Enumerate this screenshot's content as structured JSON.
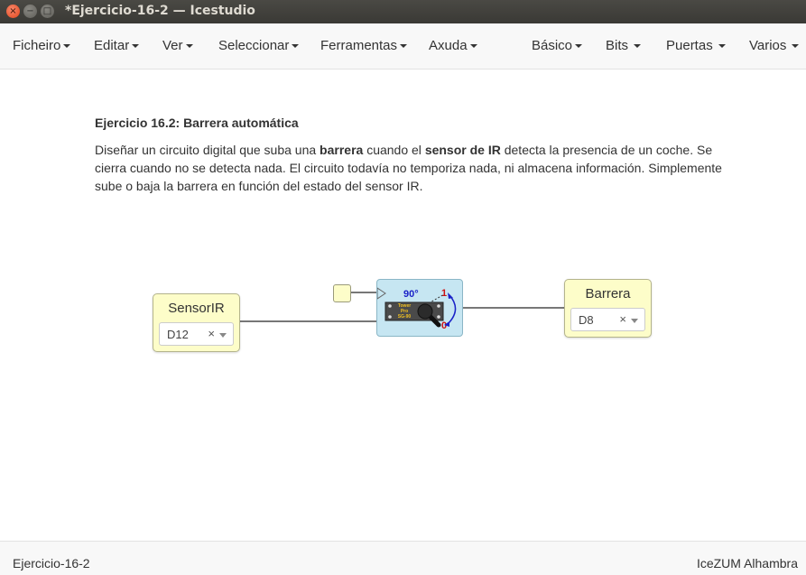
{
  "window": {
    "title": "*Ejercicio-16-2 — Icestudio",
    "close_glyph": "×",
    "min_glyph": "−",
    "max_glyph": "□"
  },
  "menubar": {
    "left": [
      "Ficheiro",
      "Editar",
      "Ver",
      "Seleccionar",
      "Ferramentas",
      "Axuda"
    ],
    "right": [
      "Básico",
      "Bits",
      "Puertas",
      "Varios"
    ]
  },
  "description": {
    "heading_bold": "Ejercicio 16.2",
    "heading_rest": ": Barrera automática",
    "p1": "Diseñar un circuito digital que suba una ",
    "b1": "barrera",
    "p2": " cuando el ",
    "b2": "sensor de IR",
    "p3": " detecta la presencia de un coche. Se cierra cuando no se detecta nada. El circuito todavía no temporiza nada, ni almacena información. Simplemente sube o baja la barrera en función del estado del sensor IR."
  },
  "circuit": {
    "input_block": {
      "name": "SensorIR",
      "pin": "D12",
      "clear": "×"
    },
    "output_block": {
      "name": "Barrera",
      "pin": "D8",
      "clear": "×"
    },
    "servo": {
      "angle": "90°",
      "label_top": "1",
      "label_bottom": "0",
      "chip_line1": "Tower",
      "chip_line2": "Pro",
      "chip_line3": "SG-90"
    }
  },
  "status": {
    "project": "Ejercicio-16-2",
    "board": "IceZUM Alhambra"
  },
  "colors": {
    "titlebar": "#3f3e3a",
    "io_block": "#fdfdc9",
    "servo_block": "#c6e6f2",
    "angle_text": "#1a22c8",
    "marker_red": "#cc1111"
  }
}
